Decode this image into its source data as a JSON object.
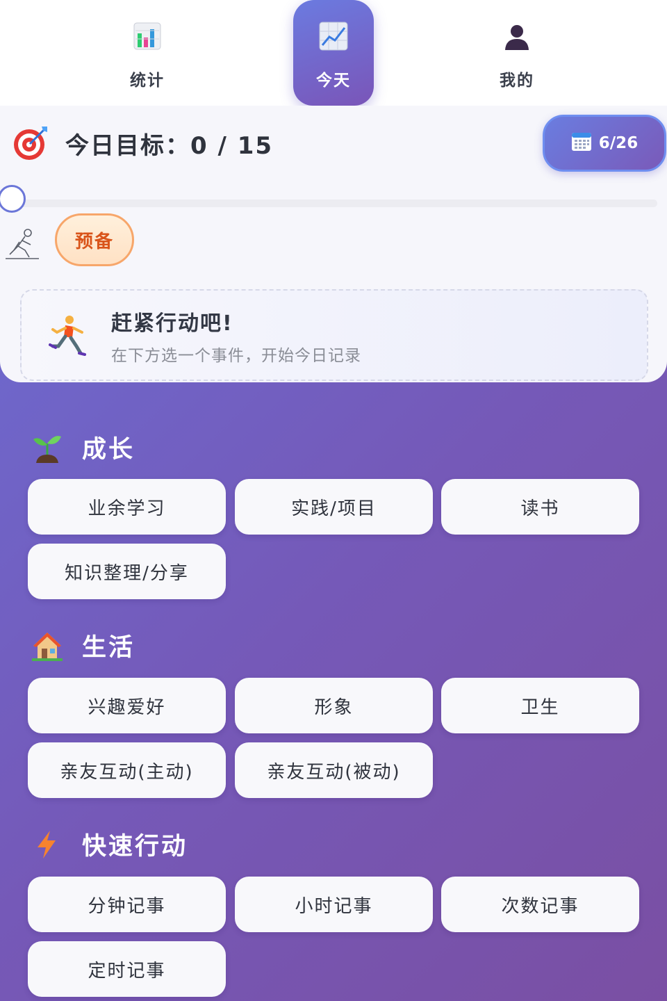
{
  "nav": {
    "stats_label": "统计",
    "today_label": "今天",
    "me_label": "我的"
  },
  "goal": {
    "title": "今日目标：0 / 15",
    "date_label": "6/26",
    "progress": 0,
    "stage_label": "预备",
    "hint_title": "赶紧行动吧!",
    "hint_sub": "在下方选一个事件，开始今日记录"
  },
  "sections": [
    {
      "title": "成长",
      "icon": "seedling-icon",
      "items": [
        "业余学习",
        "实践/项目",
        "读书",
        "知识整理/分享"
      ]
    },
    {
      "title": "生活",
      "icon": "house-icon",
      "items": [
        "兴趣爱好",
        "形象",
        "卫生",
        "亲友互动(主动)",
        "亲友互动(被动)"
      ]
    },
    {
      "title": "快速行动",
      "icon": "lightning-icon",
      "items": [
        "分钟记事",
        "小时记事",
        "次数记事",
        "定时记事"
      ]
    }
  ]
}
